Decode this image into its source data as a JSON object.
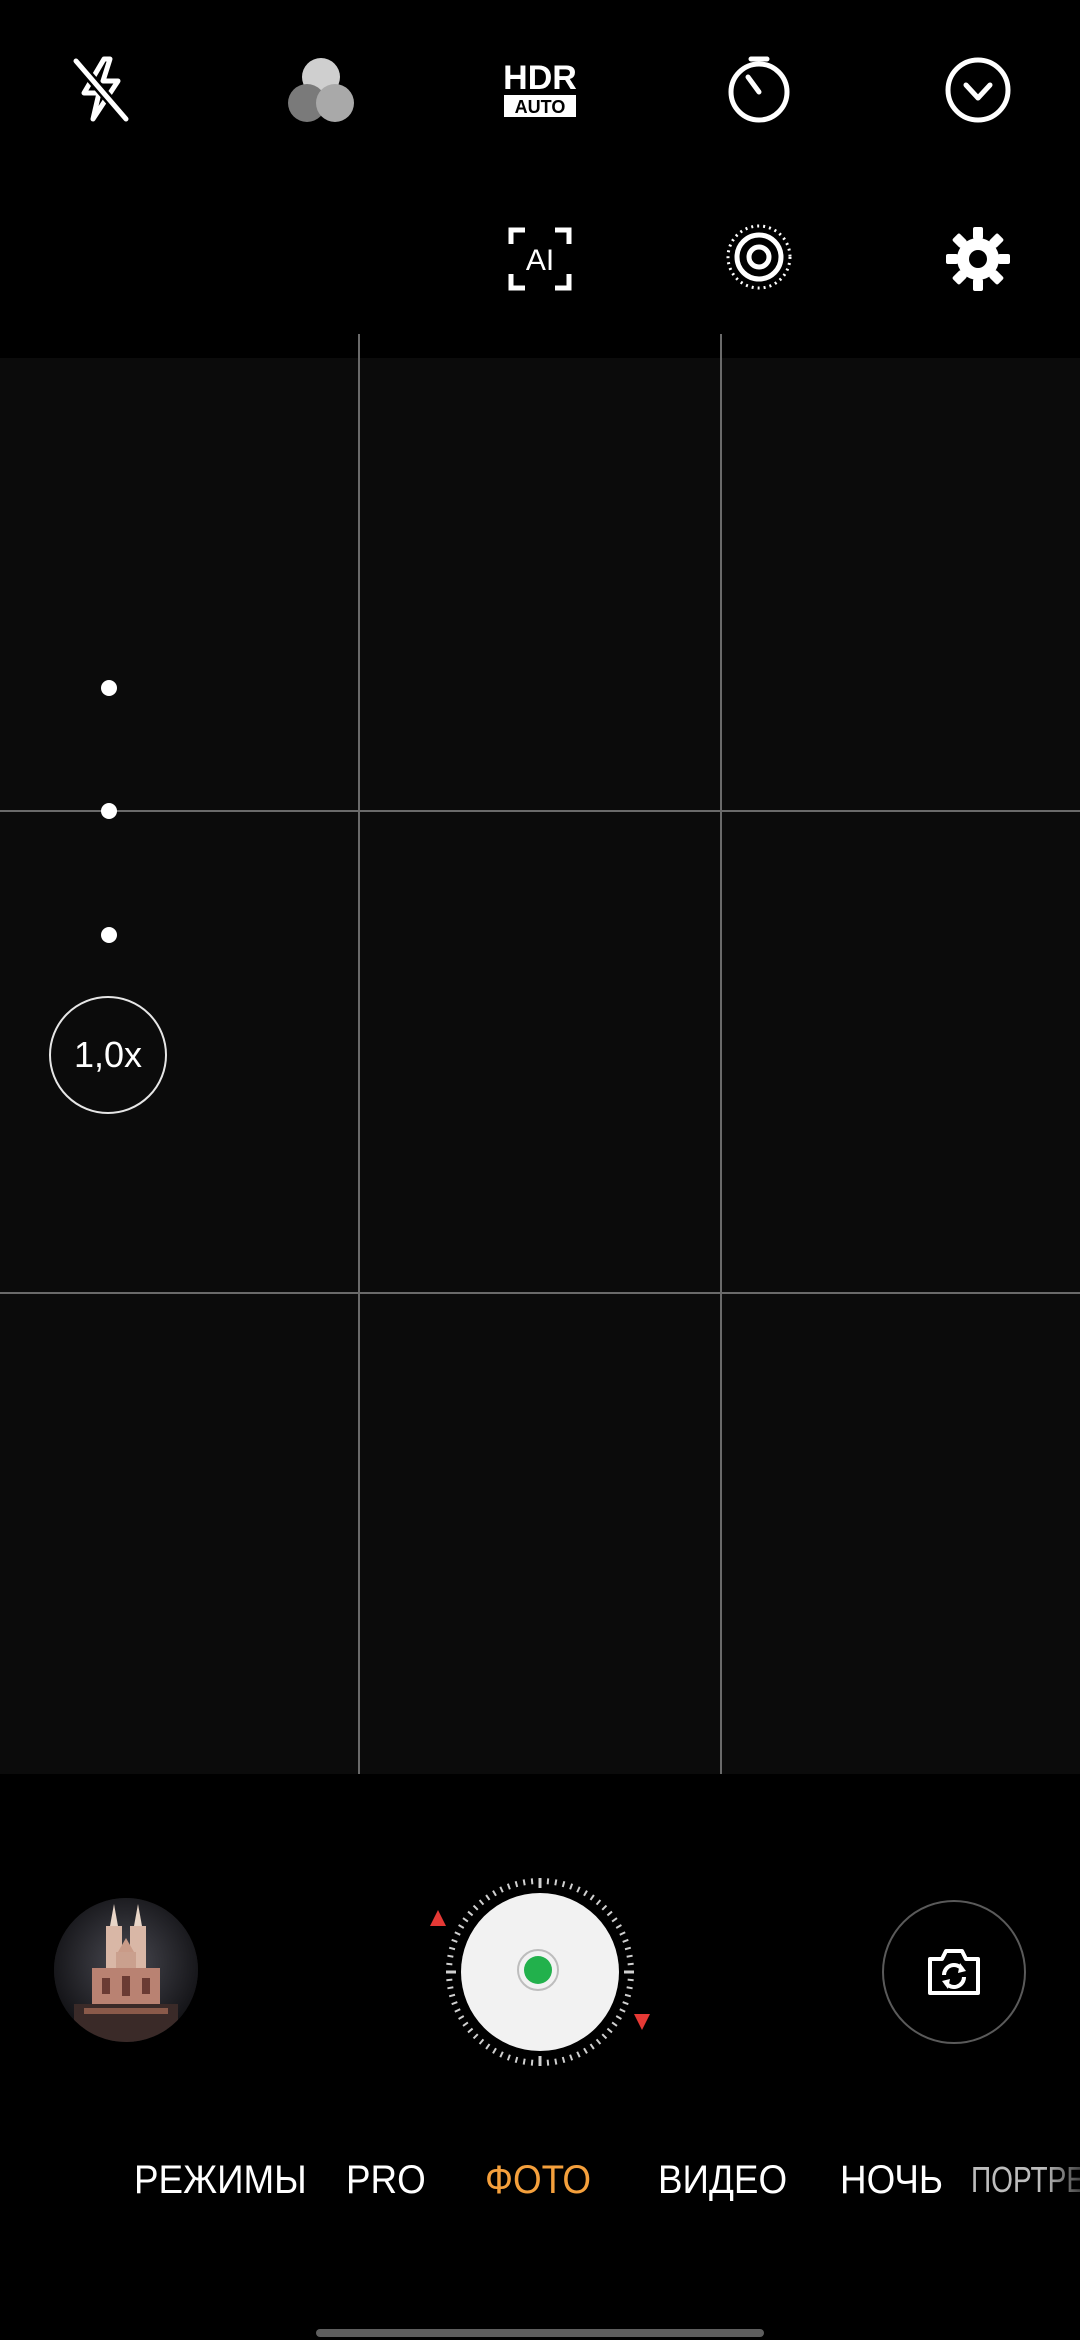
{
  "top_controls": {
    "row1": [
      {
        "icon": "flash-off-icon"
      },
      {
        "icon": "filters-icon"
      },
      {
        "icon": "hdr-auto-icon",
        "label_top": "HDR",
        "label_bottom": "AUTO"
      },
      {
        "icon": "timer-icon"
      },
      {
        "icon": "expand-chevron-icon"
      }
    ],
    "row2": [
      {
        "icon": "ai-scene-icon",
        "label": "AI"
      },
      {
        "icon": "live-photo-icon"
      },
      {
        "icon": "settings-gear-icon"
      }
    ]
  },
  "zoom": {
    "level": "1,0x"
  },
  "shutter": {
    "ready_indicator_color": "#22b14c",
    "rotate_arrow_color": "#e53935"
  },
  "modes": {
    "items": [
      "РЕЖИМЫ",
      "PRO",
      "ФОТО",
      "ВИДЕО",
      "НОЧЬ",
      "ПОРТРЕТ"
    ],
    "active": "ФОТО",
    "active_color": "#f5a03c"
  },
  "icons": {
    "gallery": "gallery-thumbnail",
    "switch_camera": "switch-camera-icon"
  }
}
